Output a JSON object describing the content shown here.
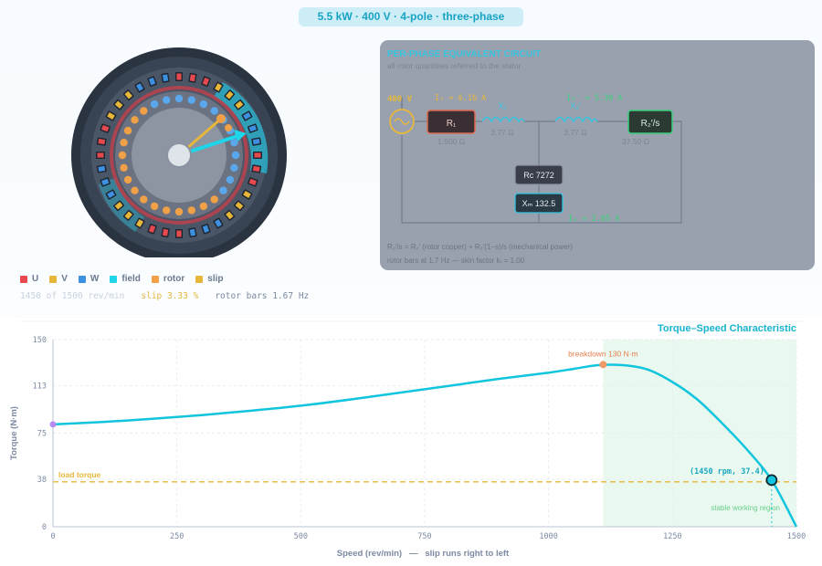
{
  "header": {
    "title": "5.5 kW · 400 V · 4-pole  ·  three-phase"
  },
  "legend": [
    {
      "label": "U",
      "color": "#e5484d"
    },
    {
      "label": "V",
      "color": "#e6b73a"
    },
    {
      "label": "W",
      "color": "#3d8fe0"
    },
    {
      "label": "field",
      "color": "#1fd5ea"
    },
    {
      "label": "rotor",
      "color": "#f0a046"
    },
    {
      "label": "slip",
      "color": "#e6b73a"
    }
  ],
  "status": {
    "speed": "1450 of 1500 rev/min",
    "slip": "slip 3.33 %",
    "rotor_bars": "rotor bars 1.67 Hz"
  },
  "circuit": {
    "title": "PER-PHASE EQUIVALENT CIRCUIT",
    "subtitle": "all rotor quantities referred to the stator",
    "source_voltage": "400 V",
    "i1": "I₁ = 6.16 A",
    "i2": "I₂′ = 5.30 A",
    "im": "Iₘ = 2.85 A",
    "r1_label": "R₁",
    "r1_value": "1.500 Ω",
    "x1_label": "X₁",
    "x1_value": "3.77 Ω",
    "x2_label": "X₂′",
    "x2_value": "3.77 Ω",
    "r2s_label": "R₂′/s",
    "r2s_value": "37.50 Ω",
    "rc_label": "Rc 7272",
    "xm_label": "Xₘ 132.5",
    "note1": "R₂′/s = R₂′ (rotor copper) + R₂′(1−s)/s (mechanical power)",
    "note2": "rotor bars at 1.7 Hz — skin factor kᵣ = 1.00"
  },
  "chart_data": {
    "type": "line",
    "title": "Torque–Speed Characteristic",
    "xlabel": "Speed (rev/min)   —   slip runs right to left",
    "ylabel": "Torque (N·m)",
    "xlim": [
      0,
      1500
    ],
    "ylim": [
      0,
      150
    ],
    "xticks": [
      "0",
      "250",
      "500",
      "750",
      "1000",
      "1250",
      "1500"
    ],
    "yticks": [
      "0",
      "38",
      "75",
      "113",
      "150"
    ],
    "x": [
      0,
      100,
      200,
      300,
      400,
      500,
      600,
      700,
      800,
      900,
      1000,
      1050,
      1100,
      1150,
      1200,
      1250,
      1300,
      1350,
      1400,
      1450,
      1500
    ],
    "y": [
      82,
      84,
      86.5,
      89.5,
      93,
      97,
      102,
      107.5,
      113,
      118.5,
      123.5,
      126.5,
      129.5,
      129.5,
      126,
      116,
      102,
      83,
      62,
      37.4,
      0
    ],
    "load_torque": {
      "label": "load torque",
      "value": 36
    },
    "breakdown": {
      "label": "breakdown 130 N·m",
      "speed": 1110,
      "torque": 130
    },
    "operating_point": {
      "label": "(1450 rpm, 37.4)",
      "speed": 1450,
      "torque": 37.4
    },
    "start_point": {
      "speed": 0,
      "torque": 82
    },
    "stable_region": {
      "label": "stable working region",
      "from": 1110,
      "to": 1500
    }
  }
}
